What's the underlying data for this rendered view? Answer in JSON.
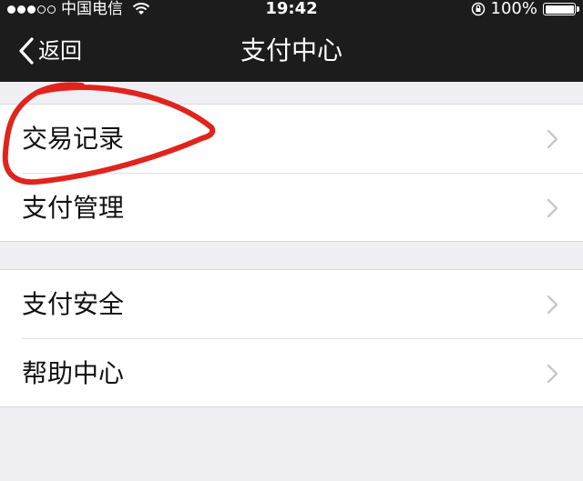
{
  "status_bar": {
    "carrier": "中国电信",
    "time": "19:42",
    "battery": "100%",
    "battery_level": 1.0,
    "signal_bars_filled": 3,
    "signal_bars_total": 5,
    "icons": [
      "signal-icon",
      "wifi-icon",
      "orientation-lock-icon",
      "battery-icon"
    ]
  },
  "nav": {
    "back_label": "返回",
    "title": "支付中心"
  },
  "groups": [
    {
      "items": [
        {
          "label": "交易记录",
          "icon": "chevron-right-icon"
        },
        {
          "label": "支付管理",
          "icon": "chevron-right-icon"
        }
      ]
    },
    {
      "items": [
        {
          "label": "支付安全",
          "icon": "chevron-right-icon"
        },
        {
          "label": "帮助中心",
          "icon": "chevron-right-icon"
        }
      ]
    }
  ],
  "colors": {
    "bar_background": "#1c1c1c",
    "page_background": "#efeff4",
    "cell_background": "#ffffff",
    "annotation": "#e0241c",
    "chevron": "#c7c7cc"
  }
}
